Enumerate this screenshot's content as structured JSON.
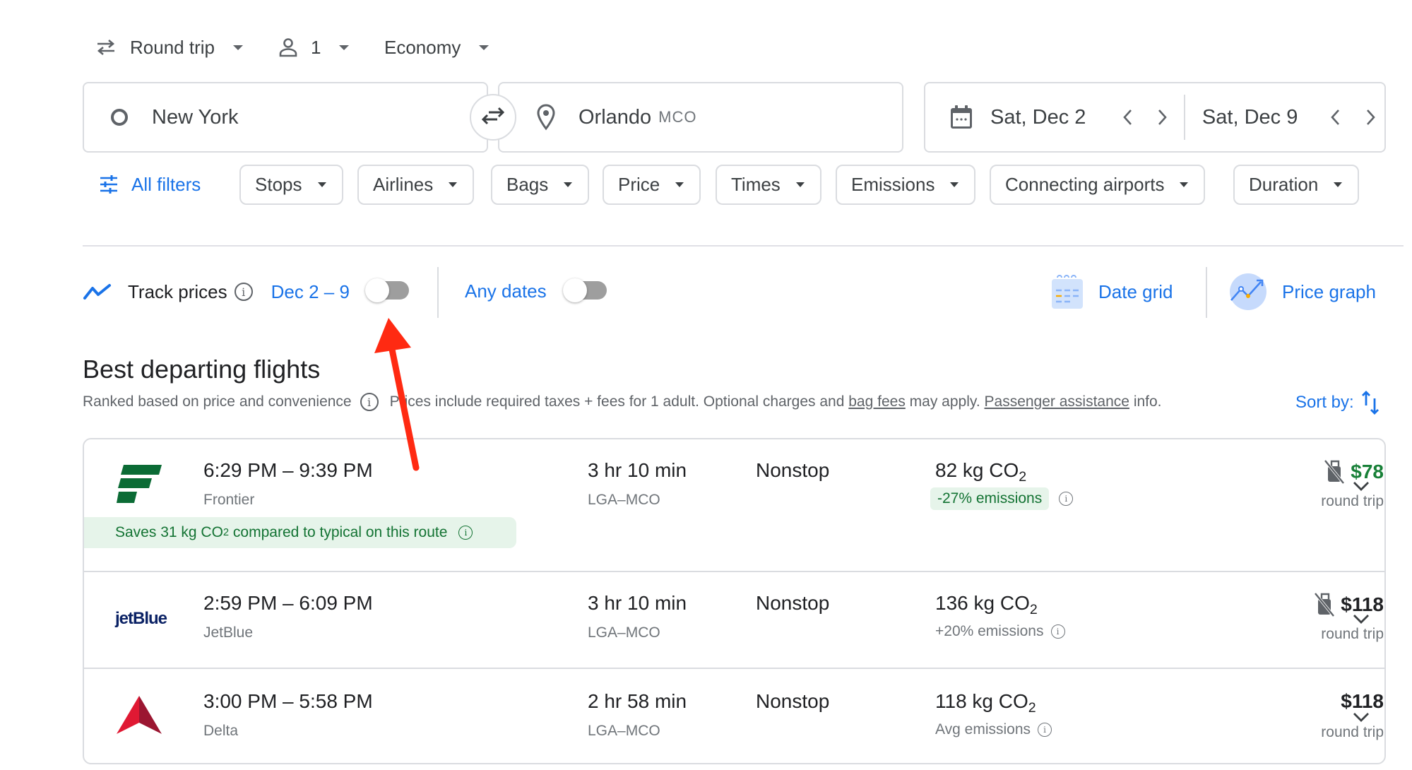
{
  "toolbar": {
    "trip_type": "Round trip",
    "passengers": "1",
    "cabin_class": "Economy"
  },
  "search": {
    "origin": "New York",
    "destination": "Orlando",
    "destination_code": "MCO",
    "depart_date": "Sat, Dec 2",
    "return_date": "Sat, Dec 9"
  },
  "filters": {
    "all_filters_label": "All filters",
    "chips": [
      "Stops",
      "Airlines",
      "Bags",
      "Price",
      "Times",
      "Emissions",
      "Connecting airports",
      "Duration"
    ]
  },
  "tracking": {
    "track_prices_label": "Track prices",
    "date_range": "Dec 2 – 9",
    "track_prices_on": false,
    "any_dates_label": "Any dates",
    "any_dates_on": false,
    "date_grid_label": "Date grid",
    "price_graph_label": "Price graph"
  },
  "results": {
    "heading": "Best departing flights",
    "ranked_note": "Ranked based on price and convenience",
    "prices_note_1": "Prices include required taxes + fees for 1 adult. Optional charges and",
    "bag_fees_link": "bag fees",
    "prices_note_2": "may apply.",
    "passenger_link": "Passenger assistance",
    "prices_note_3": "info.",
    "sort_label": "Sort by:",
    "flights": [
      {
        "times": "6:29 PM – 9:39 PM",
        "airline": "Frontier",
        "duration": "3 hr 10 min",
        "route": "LGA–MCO",
        "stops": "Nonstop",
        "co2_value": "82 kg CO",
        "co2_sub": "2",
        "emissions_note": "-27% emissions",
        "emissions_badge": true,
        "price": "$78",
        "price_color": "#188038",
        "no_carry_on_icon": true,
        "price_type": "round trip",
        "savings_banner": "Saves 31 kg CO",
        "savings_sub": "2",
        "savings_tail": "compared to typical on this route"
      },
      {
        "times": "2:59 PM – 6:09 PM",
        "airline": "JetBlue",
        "logo_text": "jetBlue",
        "duration": "3 hr 10 min",
        "route": "LGA–MCO",
        "stops": "Nonstop",
        "co2_value": "136 kg CO",
        "co2_sub": "2",
        "emissions_note": "+20% emissions",
        "price": "$118",
        "no_carry_on_icon": true,
        "price_type": "round trip"
      },
      {
        "times": "3:00 PM – 5:58 PM",
        "airline": "Delta",
        "duration": "2 hr 58 min",
        "route": "LGA–MCO",
        "stops": "Nonstop",
        "co2_value": "118 kg CO",
        "co2_sub": "2",
        "emissions_note": "Avg emissions",
        "price": "$118",
        "no_carry_on_icon": false,
        "price_type": "round trip"
      }
    ]
  },
  "colors": {
    "accent_blue": "#1a73e8",
    "price_green": "#188038",
    "annotation_red": "#ff2a12"
  }
}
